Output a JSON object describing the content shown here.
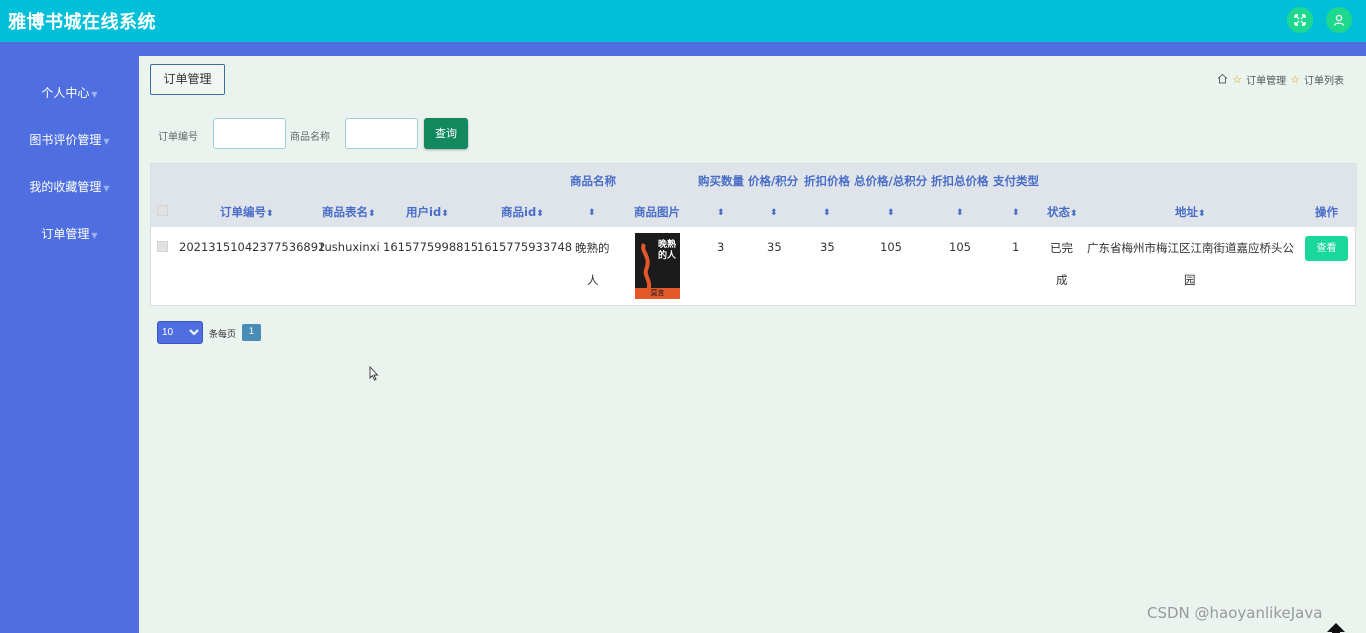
{
  "app": {
    "title": "雅博书城在线系统"
  },
  "topbar": {
    "fullscreen_icon": "fullscreen-icon",
    "user_icon": "user-icon",
    "accent": "#00c0d9",
    "button_color": "#1dd88e"
  },
  "sidebar": {
    "bg": "#4f6fe0",
    "items": [
      {
        "label": "个人中心"
      },
      {
        "label": "图书评价管理"
      },
      {
        "label": "我的收藏管理"
      },
      {
        "label": "订单管理"
      }
    ]
  },
  "content": {
    "crumb_box": "订单管理",
    "breadcrumb": {
      "level1": "订单管理",
      "level2": "订单列表"
    }
  },
  "search": {
    "order_no_label": "订单编号",
    "order_no_value": "",
    "product_name_label": "商品名称",
    "product_name_value": "",
    "query_button": "查询"
  },
  "table": {
    "top_headers": {
      "product_name": "商品名称",
      "qty": "购买数量",
      "price": "价格/积分",
      "discount_price": "折扣价格",
      "total": "总价格/总积分",
      "discount_total": "折扣总价格",
      "pay_type": "支付类型"
    },
    "columns": {
      "order_no": "订单编号",
      "product_table": "商品表名",
      "user_id": "用户id",
      "product_id": "商品id",
      "product_image": "商品图片",
      "status": "状态",
      "address": "地址",
      "action": "操作"
    },
    "rows": [
      {
        "order_no": "20213151042377536892",
        "product_table": "tushuxinxi",
        "user_id": "1615775998815",
        "product_id": "1615775933748",
        "product_name_line1": "晚熟的",
        "product_name_line2": "人",
        "qty": "3",
        "price": "35",
        "discount_price": "35",
        "total": "105",
        "discount_total": "105",
        "pay_type": "1",
        "status_line1": "已完",
        "status_line2": "成",
        "address_line1": "广东省梅州市梅江区江南街道嘉应桥头公",
        "address_line2": "园",
        "action_label": "查看",
        "cover_text": "晚熟的人",
        "cover_author": "莫言"
      }
    ]
  },
  "pager": {
    "page_size": "10",
    "per_page_label": "条每页",
    "current_page": "1"
  },
  "watermark": "CSDN @haoyanlikeJava"
}
